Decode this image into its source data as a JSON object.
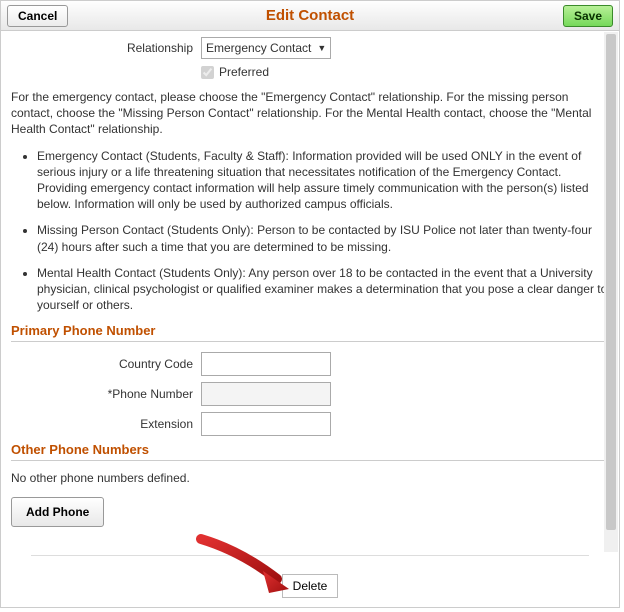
{
  "header": {
    "cancel_label": "Cancel",
    "title": "Edit Contact",
    "save_label": "Save"
  },
  "relationship": {
    "label": "Relationship",
    "value": "Emergency Contact"
  },
  "preferred": {
    "label": "Preferred",
    "checked": true
  },
  "instructions": "For the emergency contact, please choose the \"Emergency Contact\" relationship. For the missing person contact, choose the \"Missing Person Contact\" relationship. For the Mental Health contact, choose the \"Mental Health Contact\" relationship.",
  "bullets": [
    "Emergency Contact (Students, Faculty & Staff): Information provided will be used ONLY in the event of serious injury or a life threatening situation that necessitates notification of the Emergency Contact. Providing emergency contact information will help assure timely communication with the person(s) listed below. Information will only be used by authorized campus officials.",
    "Missing Person Contact (Students Only): Person to be contacted by ISU Police not later than twenty-four (24) hours after such a time that you are determined to be missing.",
    "Mental Health Contact (Students Only): Any person over 18 to be contacted in the event that a University physician, clinical psychologist or qualified examiner makes a determination that you pose a clear danger to yourself or others."
  ],
  "primary_phone": {
    "section_title": "Primary Phone Number",
    "country_code_label": "Country Code",
    "country_code_value": "",
    "phone_number_label": "*Phone Number",
    "phone_number_value": "",
    "extension_label": "Extension",
    "extension_value": ""
  },
  "other_phones": {
    "section_title": "Other Phone Numbers",
    "empty_text": "No other phone numbers defined.",
    "add_label": "Add Phone"
  },
  "delete_label": "Delete"
}
